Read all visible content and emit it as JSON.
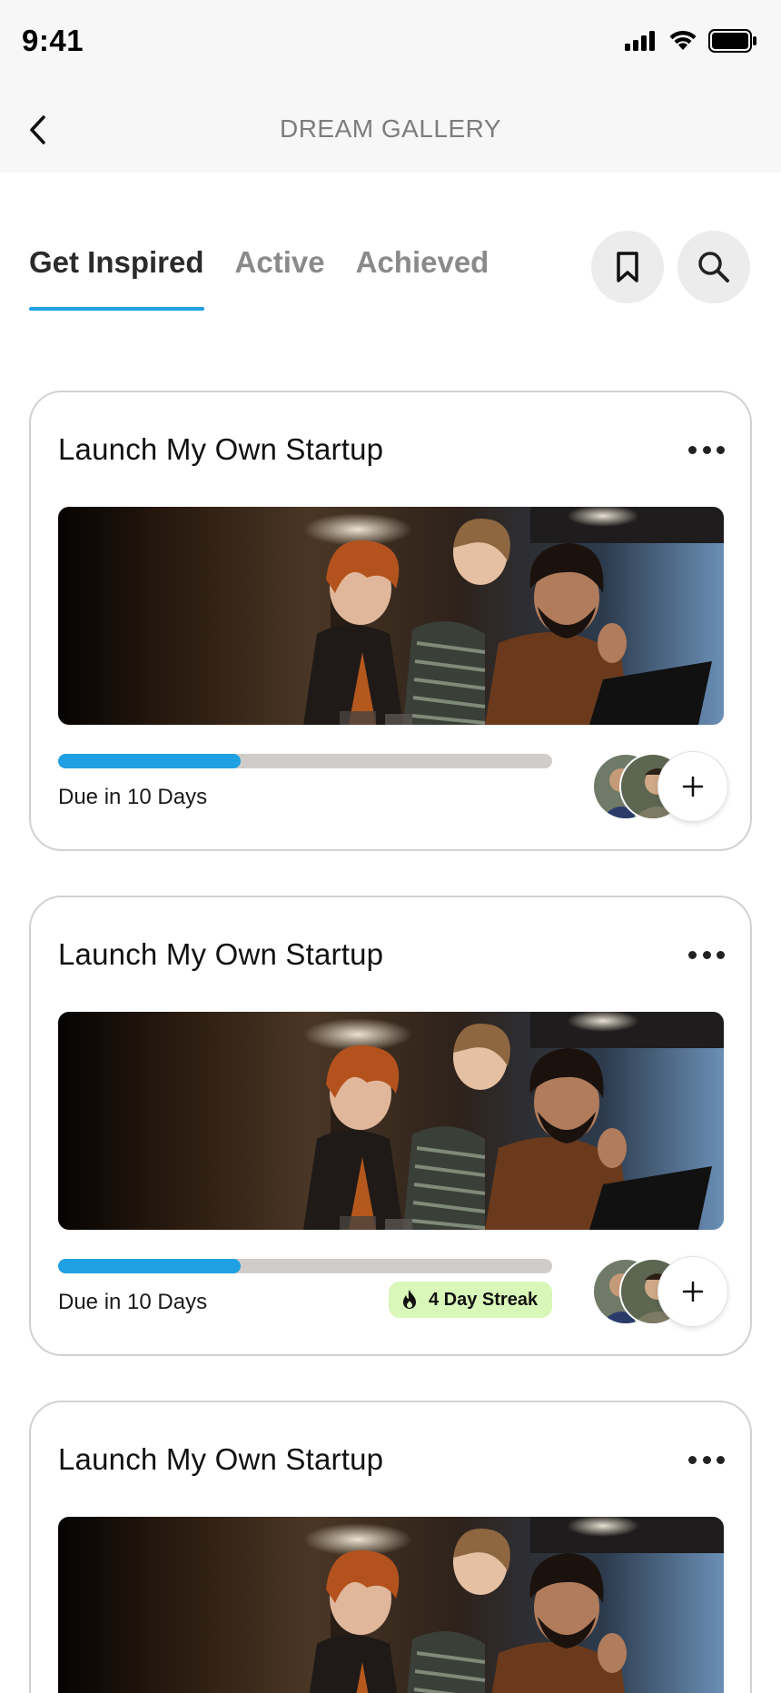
{
  "status_bar": {
    "time": "9:41",
    "icons": [
      "cellular-signal-icon",
      "wifi-icon",
      "battery-icon"
    ]
  },
  "header": {
    "back_icon": "chevron-left-icon",
    "title": "DREAM GALLERY"
  },
  "tabs": [
    {
      "label": "Get Inspired",
      "active": true
    },
    {
      "label": "Active",
      "active": false
    },
    {
      "label": "Achieved",
      "active": false
    }
  ],
  "actions": {
    "bookmark_icon": "bookmark-icon",
    "search_icon": "search-icon"
  },
  "cards": [
    {
      "title": "Launch My Own Startup",
      "progress": 0.37,
      "due_text": "Due in 10 Days",
      "streak": null
    },
    {
      "title": "Launch My Own Startup",
      "progress": 0.37,
      "due_text": "Due in 10 Days",
      "streak": {
        "icon": "flame-icon",
        "label": "4 Day Streak"
      }
    },
    {
      "title": "Launch My Own Startup",
      "progress": null,
      "due_text": null,
      "streak": null
    }
  ],
  "colors": {
    "accent": "#1ea0e2",
    "progress_track": "#d0ccc9",
    "streak_bg": "#d9f7b8",
    "card_border": "#d2d2d2",
    "header_bg": "#f7f7f7"
  }
}
